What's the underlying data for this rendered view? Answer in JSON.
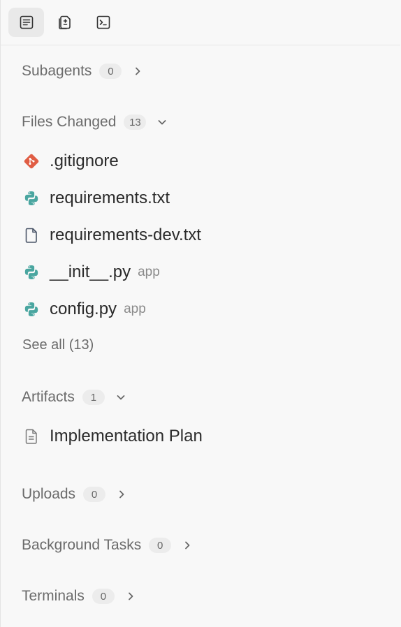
{
  "toolbar": {
    "buttons": [
      {
        "icon": "document-list-icon",
        "active": true
      },
      {
        "icon": "diff-document-icon",
        "active": false
      },
      {
        "icon": "terminal-icon",
        "active": false
      }
    ]
  },
  "sections": {
    "subagents": {
      "title": "Subagents",
      "count": "0",
      "expanded": false
    },
    "files_changed": {
      "title": "Files Changed",
      "count": "13",
      "expanded": true,
      "files": [
        {
          "name": ".gitignore",
          "dir": "",
          "icon": "git-icon"
        },
        {
          "name": "requirements.txt",
          "dir": "",
          "icon": "python-icon"
        },
        {
          "name": "requirements-dev.txt",
          "dir": "",
          "icon": "file-icon"
        },
        {
          "name": "__init__.py",
          "dir": "app",
          "icon": "python-icon"
        },
        {
          "name": "config.py",
          "dir": "app",
          "icon": "python-icon"
        }
      ],
      "see_all": "See all (13)"
    },
    "artifacts": {
      "title": "Artifacts",
      "count": "1",
      "expanded": true,
      "items": [
        {
          "name": "Implementation Plan",
          "icon": "document-icon"
        }
      ]
    },
    "uploads": {
      "title": "Uploads",
      "count": "0",
      "expanded": false
    },
    "background_tasks": {
      "title": "Background Tasks",
      "count": "0",
      "expanded": false
    },
    "terminals": {
      "title": "Terminals",
      "count": "0",
      "expanded": false
    }
  },
  "colors": {
    "git": "#e05d44",
    "python": "#4aa6a0",
    "muted_text": "#6b6b6b",
    "badge_bg": "#ececec"
  }
}
